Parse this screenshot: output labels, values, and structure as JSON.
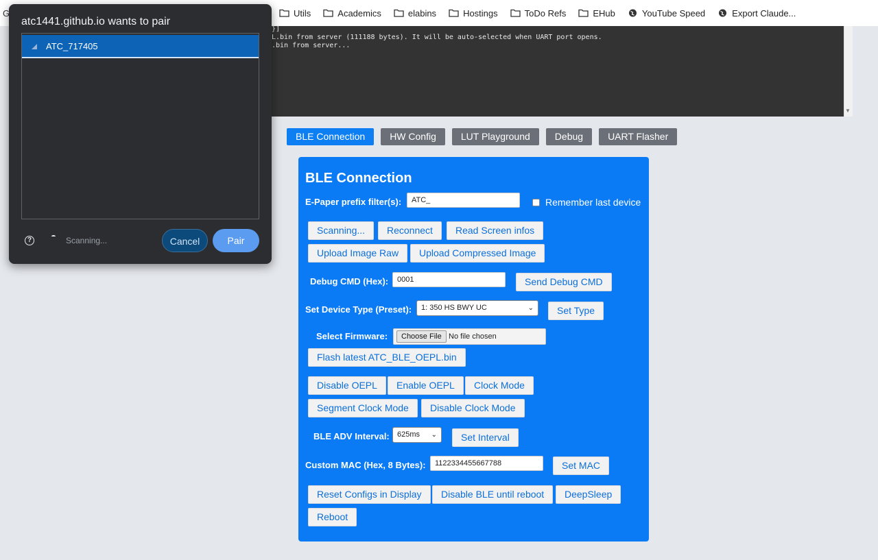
{
  "bookmarks": {
    "first": "G",
    "ghost_items": [
      "",
      "",
      "",
      "",
      ""
    ],
    "items": [
      {
        "label": "Utils",
        "icon": "folder-icon"
      },
      {
        "label": "Academics",
        "icon": "folder-icon"
      },
      {
        "label": "elabins",
        "icon": "folder-icon"
      },
      {
        "label": "Hostings",
        "icon": "folder-icon"
      },
      {
        "label": "ToDo Refs",
        "icon": "folder-icon"
      },
      {
        "label": "EHub",
        "icon": "folder-icon"
      },
      {
        "label": "YouTube Speed",
        "icon": "globe-icon"
      },
      {
        "label": "Export Claude...",
        "icon": "globe-icon"
      }
    ]
  },
  "log": {
    "lines": [
      "}]",
      "L.bin from server (111188 bytes). It will be auto-selected when UART port opens.",
      ".bin from server..."
    ]
  },
  "tabs": [
    {
      "label": "BLE Connection",
      "active": true
    },
    {
      "label": "HW Config",
      "active": false
    },
    {
      "label": "LUT Playground",
      "active": false
    },
    {
      "label": "Debug",
      "active": false
    },
    {
      "label": "UART Flasher",
      "active": false
    }
  ],
  "panel": {
    "title": "BLE Connection",
    "prefix_label": "E-Paper prefix filter(s):",
    "prefix_value": "ATC_",
    "remember_label": "Remember last device",
    "scanning_button": "Scanning...",
    "reconnect_button": "Reconnect",
    "read_screen_button": "Read Screen infos",
    "upload_raw_button": "Upload Image Raw",
    "upload_compressed_button": "Upload Compressed Image",
    "debug_cmd_label": "Debug CMD (Hex):",
    "debug_cmd_value": "0001",
    "send_debug_button": "Send Debug CMD",
    "device_type_label": "Set Device Type (Preset):",
    "device_type_value": "1: 350 HS BWY UC",
    "set_type_button": "Set Type",
    "firmware_label": "Select Firmware:",
    "choose_file_button": "Choose File",
    "file_status": "No file chosen",
    "flash_button": "Flash latest ATC_BLE_OEPL.bin",
    "disable_oepl_button": "Disable OEPL",
    "enable_oepl_button": "Enable OEPL",
    "clock_mode_button": "Clock Mode",
    "segment_clock_button": "Segment Clock Mode",
    "disable_clock_button": "Disable Clock Mode",
    "adv_interval_label": "BLE ADV Interval:",
    "adv_interval_value": "625ms",
    "set_interval_button": "Set Interval",
    "mac_label": "Custom MAC (Hex, 8 Bytes):",
    "mac_value": "1122334455667788",
    "set_mac_button": "Set MAC",
    "reset_configs_button": "Reset Configs in Display",
    "disable_ble_button": "Disable BLE until reboot",
    "deepsleep_button": "DeepSleep",
    "reboot_button": "Reboot"
  },
  "dialog": {
    "title": "atc1441.github.io wants to pair",
    "device": "ATC_717405",
    "status": "Scanning...",
    "cancel": "Cancel",
    "pair": "Pair"
  },
  "colors": {
    "panel_blue": "#0a7bf4",
    "tab_active": "#0d7ff2",
    "tab_inactive": "#6b7078",
    "dialog_bg": "#2b2d31",
    "pair_button": "#5b9cf0"
  }
}
